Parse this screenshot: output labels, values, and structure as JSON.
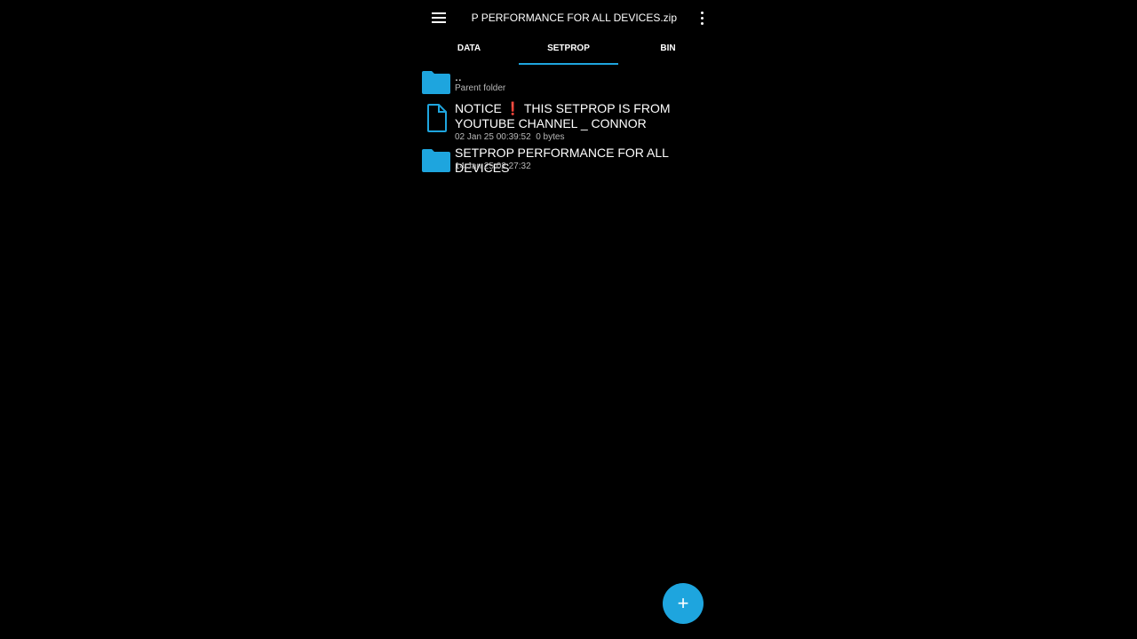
{
  "toolbar": {
    "title": "SETPROP PERFORMANCE FOR ALL DEVICES.zip",
    "menu_icon": "hamburger-menu-icon",
    "more_icon": "more-vert-icon"
  },
  "tabs": [
    {
      "label": "DATA",
      "active": false
    },
    {
      "label": "SETPROP",
      "active": true
    },
    {
      "label": "BIN",
      "active": false
    }
  ],
  "files": [
    {
      "type": "folder",
      "icon": "folder-icon",
      "name": "..",
      "meta": "Parent folder"
    },
    {
      "type": "file",
      "icon": "file-icon",
      "name_before": "NOTICE ",
      "name_mark": "❗",
      "name_after": " THIS SETPROP IS FROM YOUTUBE CHANNEL _ CONNOR",
      "meta_date": "02 Jan 25 00:39:52",
      "meta_size": "0 bytes"
    },
    {
      "type": "folder",
      "icon": "folder-icon",
      "name": "SETPROP PERFORMANCE FOR ALL DEVICES",
      "meta": "14 Jan 25 02:27:32"
    }
  ],
  "fab": {
    "label": "+",
    "icon": "plus-icon"
  },
  "colors": {
    "accent": "#1ea5de",
    "background": "#000000",
    "notice_mark": "#e53935"
  }
}
